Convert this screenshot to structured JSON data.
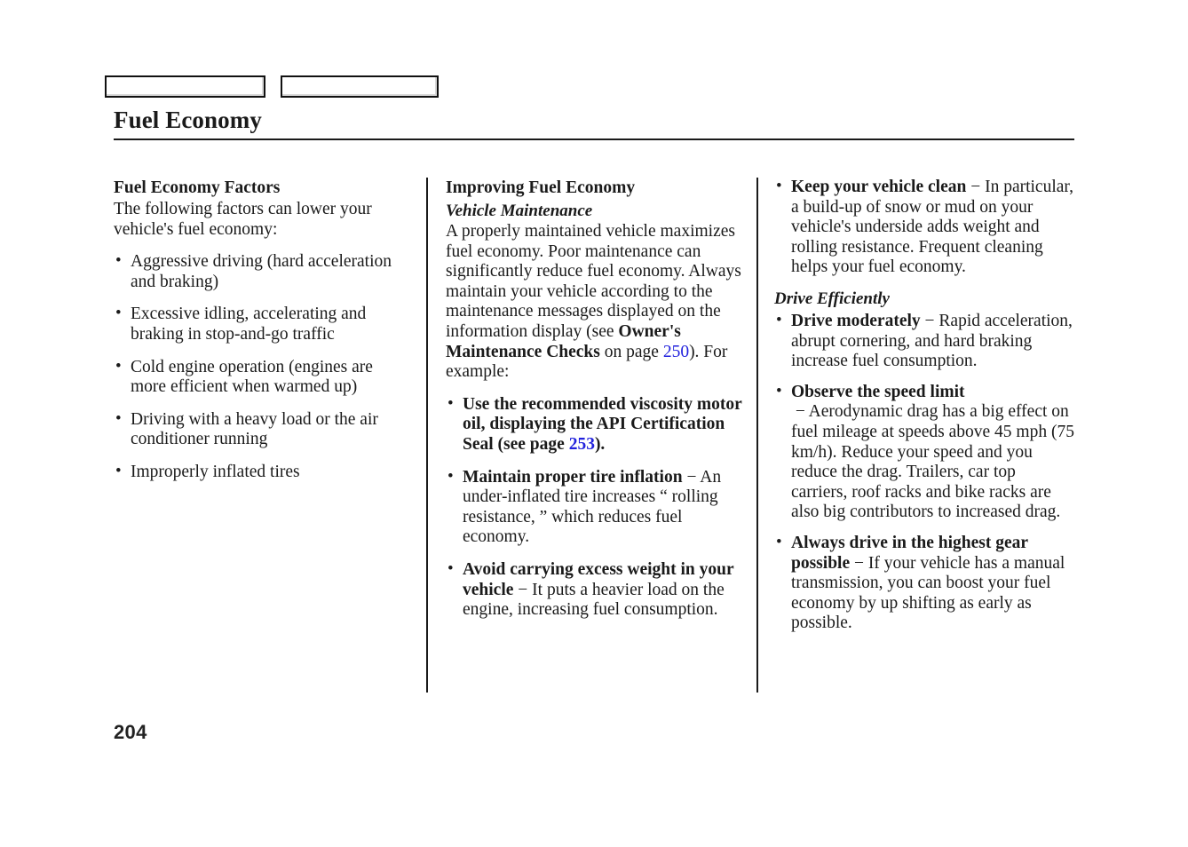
{
  "document": {
    "title": "Fuel Economy",
    "page_number": "204",
    "link_color": "#2222dd"
  },
  "header": {
    "tabs": [
      {
        "label": ""
      },
      {
        "label": ""
      }
    ]
  },
  "columns": {
    "col1": {
      "heading": "Fuel Economy Factors",
      "intro": "The following factors can lower your vehicle's fuel economy:",
      "bullets": [
        "Aggressive driving (hard acceleration and braking)",
        "Excessive idling, accelerating and braking in stop-and-go traffic",
        "Cold engine operation (engines are more efficient when warmed up)",
        "Driving with a heavy load or the air conditioner running",
        "Improperly inflated tires"
      ]
    },
    "col2": {
      "heading": "Improving Fuel Economy",
      "subheading": "Vehicle Maintenance",
      "paragraph_part1": "A properly maintained vehicle maximizes fuel economy. Poor maintenance can significantly reduce fuel economy. Always maintain your vehicle according to the maintenance messages displayed on the information display (see ",
      "paragraph_bold_ref": "Owner's Maintenance Checks",
      "paragraph_part2": " on page ",
      "paragraph_page_link": "250",
      "paragraph_part3": "). For example:",
      "bullets": [
        {
          "bold_lead": "Use the recommended viscosity motor oil, displaying the API Certification Seal (see page ",
          "page_link": "253",
          "bold_tail": ").",
          "dash": "",
          "rest": ""
        },
        {
          "bold_lead": "Maintain proper tire inflation",
          "dash": " − ",
          "rest": "An under-inflated tire increases “ rolling resistance, ” which reduces fuel economy."
        },
        {
          "bold_lead": "Avoid carrying excess weight in your vehicle",
          "dash": " − ",
          "rest": "It puts a heavier load on the engine, increasing fuel consumption."
        }
      ]
    },
    "col3": {
      "bullet_clean": {
        "bold_lead": "Keep your vehicle clean",
        "dash": " − ",
        "rest": "In particular, a build-up of snow or mud on your vehicle's underside adds weight and rolling resistance. Frequent cleaning helps your fuel economy."
      },
      "subheading": "Drive Efficiently",
      "bullets": [
        {
          "bold_lead": "Drive moderately",
          "dash": " − ",
          "rest": "Rapid acceleration, abrupt cornering, and hard braking increase fuel consumption."
        },
        {
          "bold_lead": "Observe the speed limit",
          "dash": " − ",
          "rest": "Aerodynamic drag has a big effect on fuel mileage at speeds above 45 mph (75 km/h). Reduce your speed and you reduce the drag. Trailers, car top carriers, roof racks and bike racks are also big contributors to increased drag."
        },
        {
          "bold_lead": "Always drive in the highest gear possible",
          "dash": " − ",
          "rest": "If your vehicle has a manual transmission, you can boost your fuel economy by up shifting as early as possible."
        }
      ]
    }
  }
}
